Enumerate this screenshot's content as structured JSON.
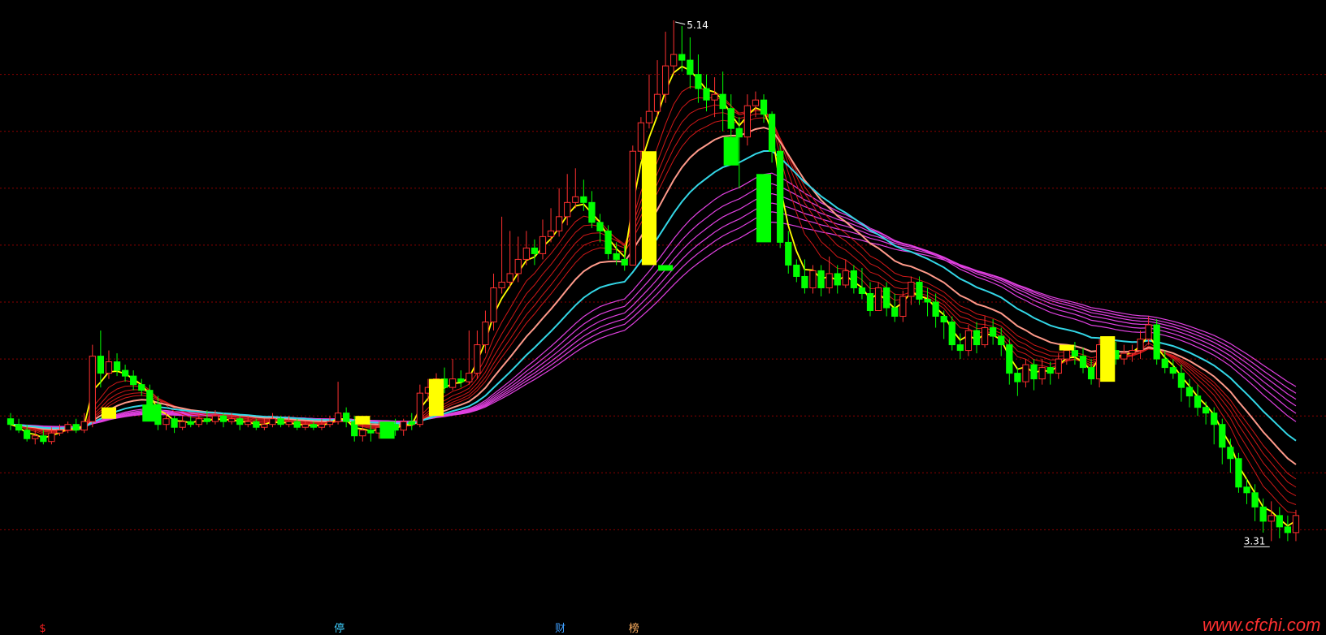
{
  "chart_data": {
    "type": "candlestick",
    "title": "",
    "ylim": [
      3.1,
      5.2
    ],
    "gridlines": [
      3.35,
      3.55,
      3.75,
      3.95,
      4.15,
      4.35,
      4.55,
      4.75,
      4.95
    ],
    "high_label": "5.14",
    "low_label": "3.31",
    "markers": [
      {
        "text": "$",
        "x_index": 4,
        "color": "#ff2020"
      },
      {
        "text": "停",
        "x_index": 40,
        "color": "#40d0ff"
      },
      {
        "text": "财",
        "x_index": 67,
        "color": "#40a0ff"
      },
      {
        "text": "榜",
        "x_index": 76,
        "color": "#ffb060"
      }
    ],
    "candles": [
      [
        3.74,
        3.72,
        3.76,
        3.7
      ],
      [
        3.72,
        3.7,
        3.74,
        3.69
      ],
      [
        3.7,
        3.67,
        3.72,
        3.66
      ],
      [
        3.67,
        3.68,
        3.7,
        3.65
      ],
      [
        3.68,
        3.66,
        3.7,
        3.65
      ],
      [
        3.66,
        3.69,
        3.71,
        3.65
      ],
      [
        3.69,
        3.7,
        3.72,
        3.68
      ],
      [
        3.7,
        3.72,
        3.73,
        3.69
      ],
      [
        3.72,
        3.7,
        3.74,
        3.69
      ],
      [
        3.7,
        3.73,
        3.76,
        3.69
      ],
      [
        3.73,
        3.96,
        4.0,
        3.71
      ],
      [
        3.96,
        3.9,
        4.05,
        3.85
      ],
      [
        3.9,
        3.94,
        3.98,
        3.88
      ],
      [
        3.94,
        3.91,
        3.97,
        3.89
      ],
      [
        3.91,
        3.89,
        3.93,
        3.87
      ],
      [
        3.89,
        3.86,
        3.91,
        3.84
      ],
      [
        3.86,
        3.84,
        3.88,
        3.82
      ],
      [
        3.84,
        3.79,
        3.86,
        3.77
      ],
      [
        3.79,
        3.72,
        3.82,
        3.7
      ],
      [
        3.72,
        3.74,
        3.76,
        3.7
      ],
      [
        3.74,
        3.71,
        3.75,
        3.69
      ],
      [
        3.71,
        3.73,
        3.75,
        3.7
      ],
      [
        3.73,
        3.72,
        3.75,
        3.71
      ],
      [
        3.72,
        3.74,
        3.76,
        3.71
      ],
      [
        3.74,
        3.73,
        3.77,
        3.72
      ],
      [
        3.73,
        3.75,
        3.77,
        3.72
      ],
      [
        3.75,
        3.73,
        3.76,
        3.71
      ],
      [
        3.73,
        3.74,
        3.76,
        3.72
      ],
      [
        3.74,
        3.72,
        3.75,
        3.7
      ],
      [
        3.72,
        3.73,
        3.75,
        3.71
      ],
      [
        3.73,
        3.71,
        3.74,
        3.7
      ],
      [
        3.71,
        3.72,
        3.74,
        3.7
      ],
      [
        3.72,
        3.74,
        3.76,
        3.71
      ],
      [
        3.74,
        3.72,
        3.75,
        3.71
      ],
      [
        3.72,
        3.73,
        3.75,
        3.71
      ],
      [
        3.73,
        3.71,
        3.74,
        3.7
      ],
      [
        3.71,
        3.72,
        3.73,
        3.7
      ],
      [
        3.72,
        3.71,
        3.73,
        3.7
      ],
      [
        3.71,
        3.72,
        3.74,
        3.7
      ],
      [
        3.72,
        3.73,
        3.75,
        3.71
      ],
      [
        3.73,
        3.76,
        3.87,
        3.72
      ],
      [
        3.76,
        3.73,
        3.78,
        3.71
      ],
      [
        3.73,
        3.68,
        3.75,
        3.66
      ],
      [
        3.68,
        3.7,
        3.72,
        3.66
      ],
      [
        3.7,
        3.69,
        3.72,
        3.66
      ],
      [
        3.69,
        3.71,
        3.73,
        3.67
      ],
      [
        3.71,
        3.72,
        3.73,
        3.69
      ],
      [
        3.72,
        3.7,
        3.74,
        3.68
      ],
      [
        3.7,
        3.73,
        3.74,
        3.68
      ],
      [
        3.73,
        3.72,
        3.76,
        3.7
      ],
      [
        3.72,
        3.83,
        3.86,
        3.71
      ],
      [
        3.83,
        3.85,
        3.88,
        3.8
      ],
      [
        3.85,
        3.88,
        3.9,
        3.83
      ],
      [
        3.88,
        3.85,
        3.92,
        3.83
      ],
      [
        3.85,
        3.88,
        3.95,
        3.84
      ],
      [
        3.88,
        3.87,
        3.91,
        3.85
      ],
      [
        3.87,
        3.9,
        4.05,
        3.86
      ],
      [
        3.9,
        4.0,
        4.05,
        3.88
      ],
      [
        4.0,
        4.08,
        4.12,
        3.97
      ],
      [
        4.08,
        4.2,
        4.25,
        4.05
      ],
      [
        4.2,
        4.22,
        4.45,
        4.18
      ],
      [
        4.22,
        4.25,
        4.4,
        4.2
      ],
      [
        4.25,
        4.3,
        4.38,
        4.22
      ],
      [
        4.3,
        4.34,
        4.4,
        4.28
      ],
      [
        4.34,
        4.32,
        4.37,
        4.28
      ],
      [
        4.32,
        4.38,
        4.44,
        4.3
      ],
      [
        4.38,
        4.4,
        4.48,
        4.36
      ],
      [
        4.4,
        4.45,
        4.55,
        4.38
      ],
      [
        4.45,
        4.5,
        4.6,
        4.42
      ],
      [
        4.5,
        4.52,
        4.62,
        4.48
      ],
      [
        4.52,
        4.5,
        4.58,
        4.47
      ],
      [
        4.5,
        4.43,
        4.54,
        4.41
      ],
      [
        4.43,
        4.4,
        4.46,
        4.36
      ],
      [
        4.4,
        4.32,
        4.42,
        4.3
      ],
      [
        4.32,
        4.3,
        4.36,
        4.28
      ],
      [
        4.3,
        4.28,
        4.35,
        4.26
      ],
      [
        4.28,
        4.68,
        4.7,
        4.28
      ],
      [
        4.68,
        4.78,
        4.8,
        4.65
      ],
      [
        4.78,
        4.82,
        4.95,
        4.76
      ],
      [
        4.82,
        4.88,
        5.0,
        4.8
      ],
      [
        4.88,
        4.98,
        5.1,
        4.85
      ],
      [
        4.98,
        5.02,
        5.14,
        4.95
      ],
      [
        5.02,
        5.0,
        5.12,
        4.96
      ],
      [
        5.0,
        4.95,
        5.08,
        4.9
      ],
      [
        4.95,
        4.9,
        5.02,
        4.85
      ],
      [
        4.9,
        4.86,
        4.95,
        4.82
      ],
      [
        4.86,
        4.88,
        4.94,
        4.8
      ],
      [
        4.88,
        4.83,
        4.96,
        4.75
      ],
      [
        4.83,
        4.76,
        4.88,
        4.7
      ],
      [
        4.76,
        4.73,
        4.8,
        4.55
      ],
      [
        4.73,
        4.84,
        4.88,
        4.7
      ],
      [
        4.84,
        4.86,
        4.89,
        4.8
      ],
      [
        4.86,
        4.81,
        4.88,
        4.78
      ],
      [
        4.81,
        4.68,
        4.82,
        4.64
      ],
      [
        4.68,
        4.36,
        4.7,
        4.34
      ],
      [
        4.36,
        4.28,
        4.4,
        4.25
      ],
      [
        4.28,
        4.24,
        4.3,
        4.22
      ],
      [
        4.24,
        4.2,
        4.3,
        4.18
      ],
      [
        4.2,
        4.26,
        4.28,
        4.18
      ],
      [
        4.26,
        4.2,
        4.28,
        4.17
      ],
      [
        4.2,
        4.25,
        4.31,
        4.18
      ],
      [
        4.25,
        4.21,
        4.28,
        4.18
      ],
      [
        4.21,
        4.26,
        4.3,
        4.2
      ],
      [
        4.26,
        4.2,
        4.28,
        4.18
      ],
      [
        4.2,
        4.18,
        4.27,
        4.16
      ],
      [
        4.18,
        4.12,
        4.22,
        4.1
      ],
      [
        4.12,
        4.2,
        4.22,
        4.12
      ],
      [
        4.2,
        4.13,
        4.22,
        4.1
      ],
      [
        4.13,
        4.1,
        4.18,
        4.08
      ],
      [
        4.1,
        4.17,
        4.19,
        4.08
      ],
      [
        4.17,
        4.22,
        4.24,
        4.14
      ],
      [
        4.22,
        4.16,
        4.24,
        4.14
      ],
      [
        4.16,
        4.15,
        4.2,
        4.1
      ],
      [
        4.15,
        4.1,
        4.18,
        4.06
      ],
      [
        4.1,
        4.08,
        4.12,
        4.02
      ],
      [
        4.08,
        4.0,
        4.1,
        3.98
      ],
      [
        4.0,
        3.98,
        4.04,
        3.95
      ],
      [
        3.98,
        4.05,
        4.07,
        3.96
      ],
      [
        4.05,
        4.0,
        4.08,
        3.97
      ],
      [
        4.0,
        4.06,
        4.1,
        3.99
      ],
      [
        4.06,
        4.03,
        4.09,
        4.0
      ],
      [
        4.03,
        4.0,
        4.06,
        3.96
      ],
      [
        4.0,
        3.9,
        4.02,
        3.86
      ],
      [
        3.9,
        3.87,
        3.92,
        3.82
      ],
      [
        3.87,
        3.93,
        3.95,
        3.85
      ],
      [
        3.93,
        3.88,
        3.95,
        3.84
      ],
      [
        3.88,
        3.92,
        3.95,
        3.86
      ],
      [
        3.92,
        3.9,
        3.94,
        3.86
      ],
      [
        3.9,
        3.95,
        3.97,
        3.88
      ],
      [
        3.95,
        3.98,
        4.0,
        3.93
      ],
      [
        3.98,
        3.96,
        4.01,
        3.93
      ],
      [
        3.96,
        3.92,
        3.99,
        3.9
      ],
      [
        3.92,
        3.88,
        3.95,
        3.86
      ],
      [
        3.88,
        4.0,
        4.02,
        3.85
      ],
      [
        4.0,
        3.98,
        4.02,
        3.95
      ],
      [
        3.98,
        3.95,
        4.01,
        3.93
      ],
      [
        3.95,
        3.97,
        4.0,
        3.93
      ],
      [
        3.97,
        3.98,
        4.0,
        3.94
      ],
      [
        3.98,
        4.02,
        4.05,
        3.95
      ],
      [
        4.02,
        4.07,
        4.1,
        4.0
      ],
      [
        4.07,
        3.95,
        4.09,
        3.93
      ],
      [
        3.95,
        3.92,
        3.98,
        3.9
      ],
      [
        3.92,
        3.9,
        3.95,
        3.88
      ],
      [
        3.9,
        3.85,
        3.93,
        3.8
      ],
      [
        3.85,
        3.82,
        3.88,
        3.78
      ],
      [
        3.82,
        3.78,
        3.86,
        3.75
      ],
      [
        3.78,
        3.76,
        3.8,
        3.72
      ],
      [
        3.76,
        3.72,
        3.78,
        3.65
      ],
      [
        3.72,
        3.64,
        3.74,
        3.58
      ],
      [
        3.64,
        3.6,
        3.67,
        3.55
      ],
      [
        3.6,
        3.5,
        3.62,
        3.48
      ],
      [
        3.5,
        3.48,
        3.53,
        3.44
      ],
      [
        3.48,
        3.43,
        3.51,
        3.38
      ],
      [
        3.43,
        3.38,
        3.46,
        3.34
      ],
      [
        3.38,
        3.4,
        3.45,
        3.31
      ],
      [
        3.4,
        3.36,
        3.43,
        3.32
      ],
      [
        3.36,
        3.34,
        3.4,
        3.31
      ],
      [
        3.34,
        3.4,
        3.42,
        3.31
      ]
    ],
    "overlays": [
      {
        "kind": "yellow_block",
        "index": 12,
        "top": 3.78,
        "bottom": 3.74
      },
      {
        "kind": "yellow_block",
        "index": 43,
        "top": 3.75,
        "bottom": 3.72
      },
      {
        "kind": "yellow_block",
        "index": 52,
        "top": 3.88,
        "bottom": 3.75
      },
      {
        "kind": "yellow_block",
        "index": 78,
        "top": 4.68,
        "bottom": 4.28
      },
      {
        "kind": "green_block",
        "index": 80,
        "top": 4.28,
        "bottom": 4.26
      },
      {
        "kind": "yellow_block",
        "index": 129,
        "top": 4.0,
        "bottom": 3.98
      },
      {
        "kind": "yellow_block",
        "index": 134,
        "top": 4.03,
        "bottom": 3.87
      },
      {
        "kind": "green_block",
        "index": 88,
        "top": 4.73,
        "bottom": 4.63
      },
      {
        "kind": "green_block",
        "index": 17,
        "top": 3.79,
        "bottom": 3.73
      },
      {
        "kind": "green_block",
        "index": 46,
        "top": 3.73,
        "bottom": 3.67
      },
      {
        "kind": "green_block",
        "index": 92,
        "top": 4.6,
        "bottom": 4.36
      }
    ]
  },
  "colors": {
    "background": "#000000",
    "grid": "#8b0000",
    "up": "#ff3030",
    "down": "#00ff00",
    "highlight": "#ffff00",
    "cyan_line": "#33d6e6",
    "magenta_band": "#e040e0",
    "red_band": "#d01818",
    "yellow_line": "#ffff00",
    "salmon_line": "#ff9a8a",
    "label": "#ffffff"
  },
  "watermark": "www.cfchi.com"
}
